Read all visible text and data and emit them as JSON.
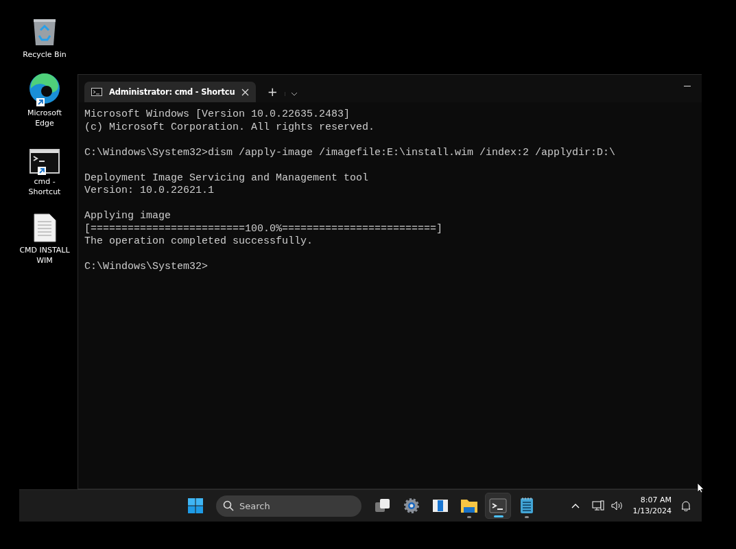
{
  "desktop_icons": [
    {
      "kind": "recycle-bin",
      "label": "Recycle Bin",
      "shortcut": false
    },
    {
      "kind": "browser",
      "label": "Microsoft Edge",
      "shortcut": true
    },
    {
      "kind": "console",
      "label": "cmd - Shortcut",
      "shortcut": true
    },
    {
      "kind": "document",
      "label": "CMD INSTALL WIM",
      "shortcut": false
    }
  ],
  "window": {
    "tabs": [
      {
        "title": "Administrator: cmd - Shortcu",
        "selected": true
      }
    ],
    "new_tab": "+",
    "output": [
      [
        "Microsoft Windows [Version 10.0.22635.2483]",
        "(c) Microsoft Corporation. All rights reserved."
      ],
      [
        "C:\\Windows\\System32>dism /apply-image /imagefile:E:\\install.wim /index:2 /applydir:D:\\"
      ],
      [
        "Deployment Image Servicing and Management tool",
        "Version: 10.0.22621.1"
      ],
      [
        "Applying image",
        "[=========================100.0%=========================]",
        "The operation completed successfully."
      ],
      [
        "C:\\Windows\\System32>"
      ]
    ]
  },
  "taskbar": {
    "search": {
      "placeholder": "Search"
    },
    "apps": [
      {
        "kind": "task-view",
        "running": false,
        "selected": false
      },
      {
        "kind": "settings",
        "running": false,
        "selected": false
      },
      {
        "kind": "widgets",
        "running": false,
        "selected": false
      },
      {
        "kind": "folder",
        "running": true,
        "selected": false
      },
      {
        "kind": "terminal",
        "running": true,
        "selected": true
      },
      {
        "kind": "notepad",
        "running": true,
        "selected": false
      }
    ],
    "time": "8:07 AM",
    "date": "1/13/2024"
  }
}
